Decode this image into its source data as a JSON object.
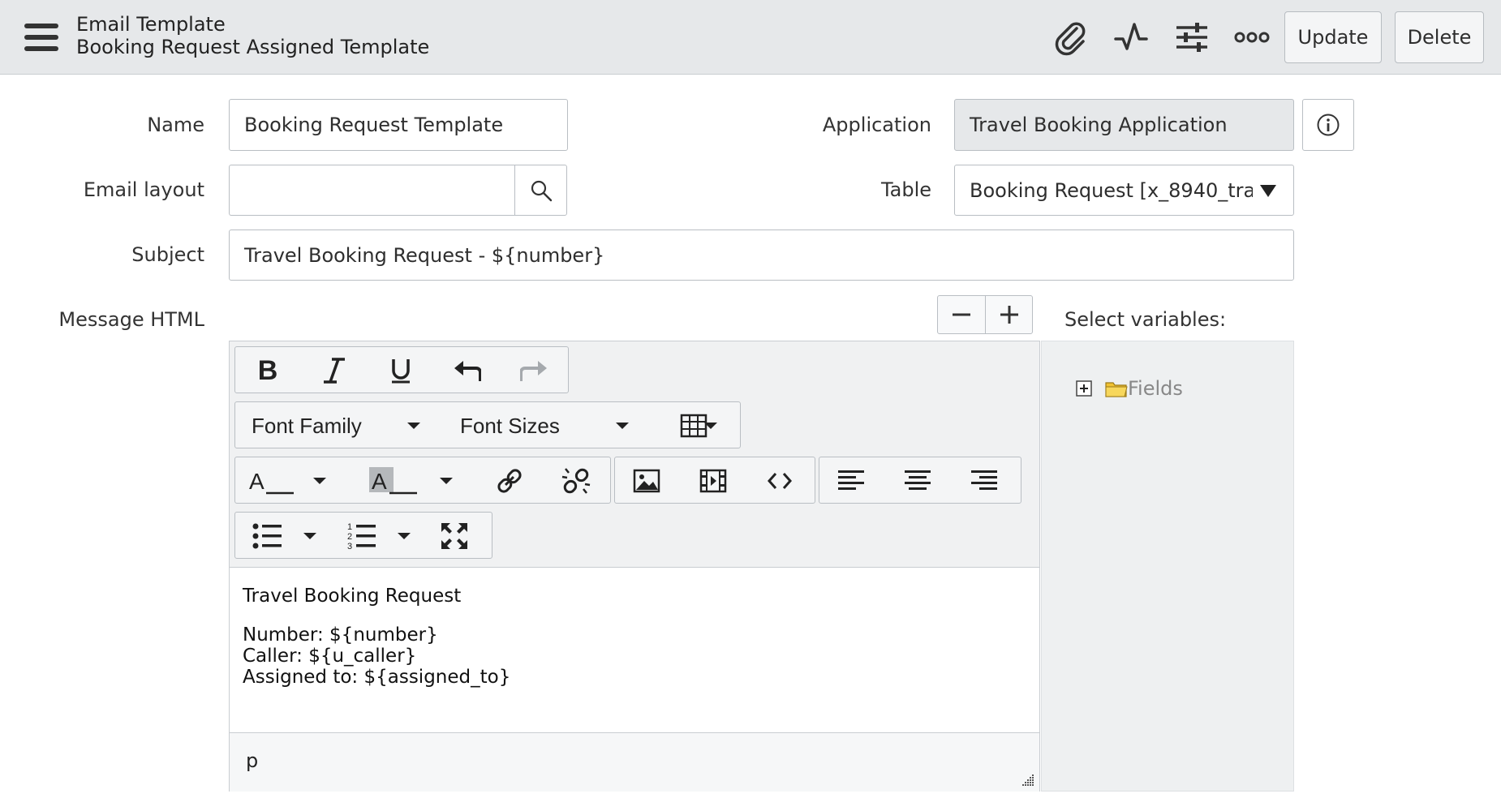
{
  "header": {
    "title": "Email Template",
    "subtitle": "Booking Request Assigned Template",
    "update_label": "Update",
    "delete_label": "Delete"
  },
  "form": {
    "name_label": "Name",
    "name_value": "Booking Request Template",
    "application_label": "Application",
    "application_value": "Travel Booking Application",
    "email_layout_label": "Email layout",
    "email_layout_value": "",
    "table_label": "Table",
    "table_value": "Booking Request [x_8940_tra…",
    "subject_label": "Subject",
    "subject_value": "Travel Booking Request - ${number}",
    "message_html_label": "Message HTML"
  },
  "editor": {
    "font_family_label": "Font Family",
    "font_sizes_label": "Font Sizes",
    "content": {
      "heading": "Travel Booking Request",
      "line1": "Number: ${number}",
      "line2": "Caller: ${u_caller}",
      "line3": "Assigned to: ${assigned_to}"
    },
    "status_path": "p"
  },
  "variables": {
    "label": "Select variables:",
    "tree_root": "Fields"
  },
  "colors": {
    "header_bg": "#e6e8ea",
    "readonly_bg": "#e6e8ea",
    "folder": "#f1c232"
  }
}
